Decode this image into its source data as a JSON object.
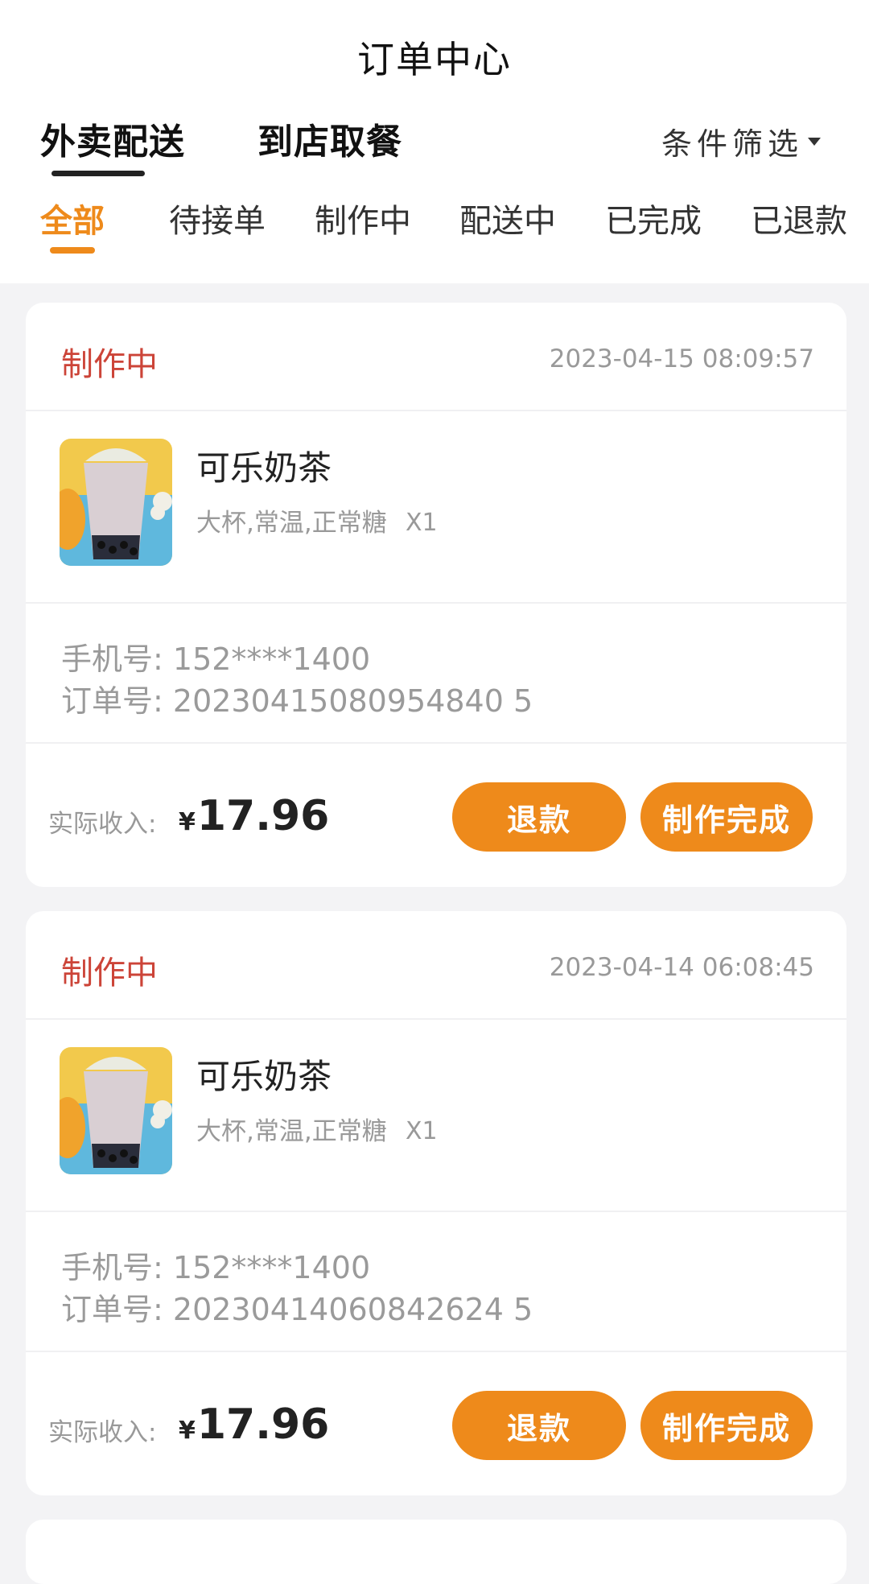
{
  "header": {
    "title": "订单中心",
    "main_tabs": [
      {
        "label": "外卖配送",
        "active": true
      },
      {
        "label": "到店取餐",
        "active": false
      }
    ],
    "filter_label": "条件筛选",
    "status_tabs": [
      {
        "label": "全部",
        "active": true
      },
      {
        "label": "待接单",
        "active": false
      },
      {
        "label": "制作中",
        "active": false
      },
      {
        "label": "配送中",
        "active": false
      },
      {
        "label": "已完成",
        "active": false
      },
      {
        "label": "已退款",
        "active": false
      }
    ]
  },
  "orders": [
    {
      "status": "制作中",
      "time": "2023-04-15 08:09:57",
      "product_name": "可乐奶茶",
      "product_spec": "大杯,常温,正常糖",
      "quantity": "X1",
      "phone_label": "手机号:",
      "phone": "152****1400",
      "order_no_label": "订单号:",
      "order_no": "20230415080954840 5",
      "income_label": "实际收入:",
      "currency": "¥",
      "amount": "17.96",
      "refund_label": "退款",
      "complete_label": "制作完成"
    },
    {
      "status": "制作中",
      "time": "2023-04-14 06:08:45",
      "product_name": "可乐奶茶",
      "product_spec": "大杯,常温,正常糖",
      "quantity": "X1",
      "phone_label": "手机号:",
      "phone": "152****1400",
      "order_no_label": "订单号:",
      "order_no": "20230414060842624 5",
      "income_label": "实际收入:",
      "currency": "¥",
      "amount": "17.96",
      "refund_label": "退款",
      "complete_label": "制作完成"
    }
  ],
  "colors": {
    "accent": "#ee8a1b",
    "status_red": "#cc4438",
    "background": "#f3f3f5"
  }
}
